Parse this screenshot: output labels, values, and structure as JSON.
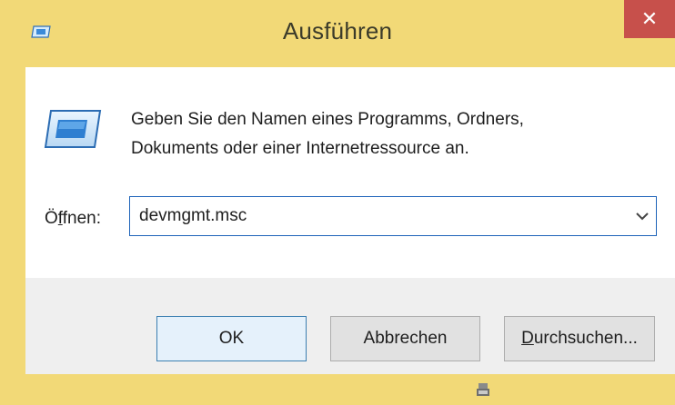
{
  "window": {
    "title": "Ausführen",
    "close_glyph": "✕",
    "title_icon": "run-icon",
    "accent_color": "#f2d977",
    "close_color": "#c7504b"
  },
  "dialog": {
    "icon": "run-icon",
    "description_line1": "Geben Sie den Namen eines Programms, Ordners,",
    "description_line2": "Dokuments oder einer Internetressource an.",
    "open_label_accesskey": "f",
    "open_label_prefix": "Ö",
    "open_label_suffix": "fnen:",
    "input_value": "devmgmt.msc",
    "dropdown_icon": "chevron-down-icon"
  },
  "buttons": {
    "ok_label": "OK",
    "cancel_label": "Abbrechen",
    "browse_accesskey": "D",
    "browse_rest": "urchsuchen..."
  },
  "status": {
    "grip_icon": "resize-grip-icon"
  }
}
